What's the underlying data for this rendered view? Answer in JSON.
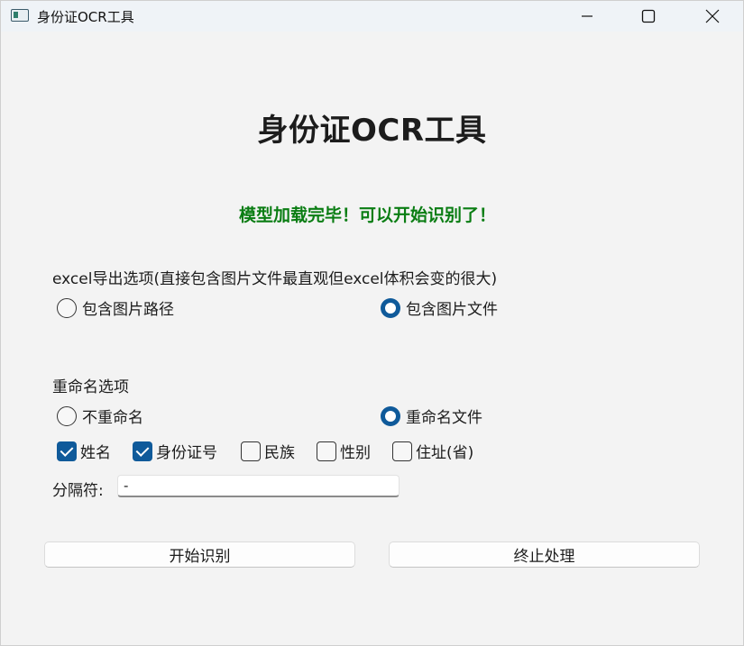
{
  "window": {
    "title": "身份证OCR工具",
    "controls": [
      "minimize",
      "maximize",
      "close"
    ]
  },
  "main": {
    "heading": "身份证OCR工具",
    "status": "模型加载完毕！可以开始识别了！",
    "status_color": "#0a7d13"
  },
  "excel_options": {
    "label": "excel导出选项(直接包含图片文件最直观但excel体积会变的很大)",
    "options": [
      {
        "label": "包含图片路径",
        "selected": false
      },
      {
        "label": "包含图片文件",
        "selected": true
      }
    ]
  },
  "rename_options": {
    "label": "重命名选项",
    "options": [
      {
        "label": "不重命名",
        "selected": false
      },
      {
        "label": "重命名文件",
        "selected": true
      }
    ],
    "fields": [
      {
        "label": "姓名",
        "checked": true
      },
      {
        "label": "身份证号",
        "checked": true
      },
      {
        "label": "民族",
        "checked": false
      },
      {
        "label": "性别",
        "checked": false
      },
      {
        "label": "住址(省)",
        "checked": false
      }
    ]
  },
  "separator": {
    "label": "分隔符:",
    "value": "-"
  },
  "actions": {
    "start_label": "开始识别",
    "stop_label": "终止处理"
  },
  "colors": {
    "accent": "#0f5a9a",
    "background": "#f3f3f3"
  }
}
